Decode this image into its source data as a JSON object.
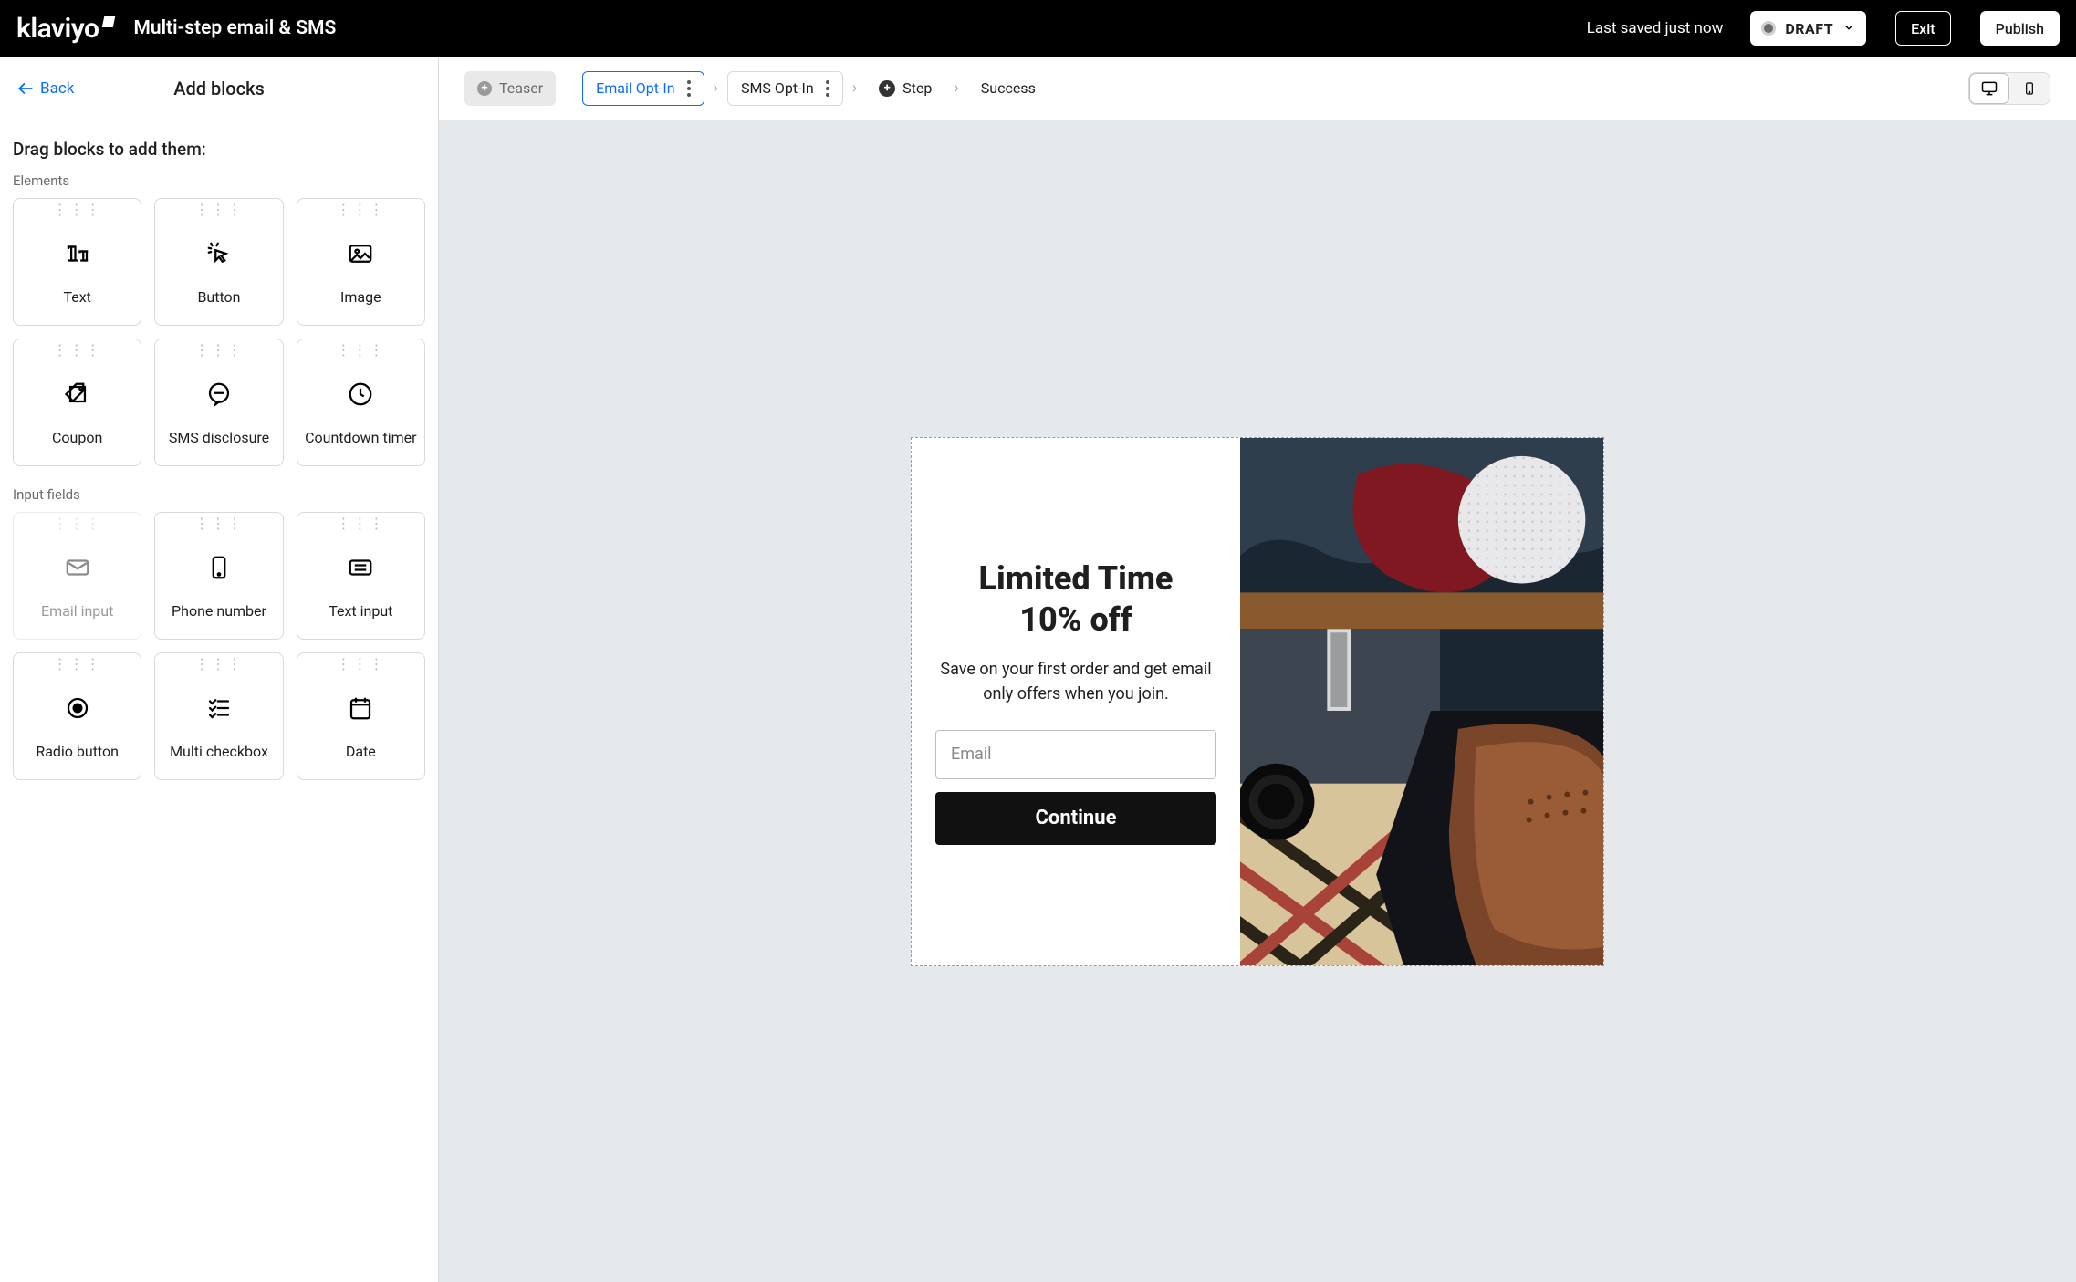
{
  "header": {
    "logo": "klaviyo",
    "title": "Multi-step email & SMS",
    "saved": "Last saved just now",
    "status": "DRAFT",
    "exit": "Exit",
    "publish": "Publish"
  },
  "sidebar": {
    "back": "Back",
    "title": "Add blocks",
    "drag_heading": "Drag blocks to add them:",
    "categories": {
      "elements": {
        "label": "Elements",
        "items": [
          {
            "id": "text",
            "label": "Text"
          },
          {
            "id": "button",
            "label": "Button"
          },
          {
            "id": "image",
            "label": "Image"
          },
          {
            "id": "coupon",
            "label": "Coupon"
          },
          {
            "id": "sms-disclosure",
            "label": "SMS disclosure"
          },
          {
            "id": "countdown",
            "label": "Countdown timer"
          }
        ]
      },
      "inputs": {
        "label": "Input fields",
        "items": [
          {
            "id": "email-input",
            "label": "Email input",
            "disabled": true
          },
          {
            "id": "phone",
            "label": "Phone number"
          },
          {
            "id": "text-input",
            "label": "Text input"
          },
          {
            "id": "radio",
            "label": "Radio button"
          },
          {
            "id": "multi-checkbox",
            "label": "Multi checkbox"
          },
          {
            "id": "date",
            "label": "Date"
          }
        ]
      }
    }
  },
  "steps": {
    "teaser": "Teaser",
    "email": "Email Opt-In",
    "sms": "SMS Opt-In",
    "step": "Step",
    "success": "Success"
  },
  "preview": {
    "heading_line1": "Limited Time",
    "heading_line2": "10% off",
    "subtext": "Save on your first order and get email only offers when you join.",
    "email_placeholder": "Email",
    "cta": "Continue"
  },
  "colors": {
    "link": "#0a6cff",
    "canvas_bg": "#e6e9ec"
  }
}
